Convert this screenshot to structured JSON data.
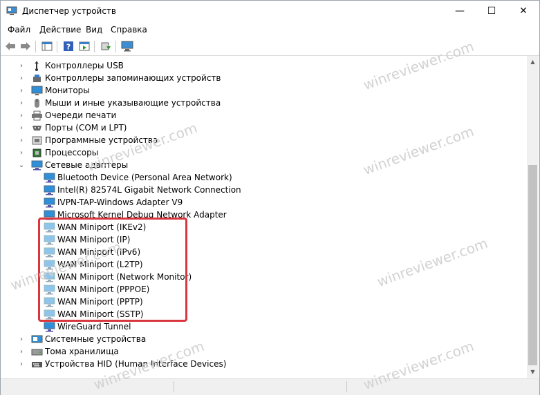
{
  "window": {
    "title": "Диспетчер устройств",
    "minimize": "—",
    "maximize": "☐",
    "close": "✕"
  },
  "menu": [
    "Файл",
    "Действие",
    "Вид",
    "Справка"
  ],
  "tree": [
    {
      "label": "Контроллеры USB",
      "icon": "usb-controller-icon",
      "expander": "›"
    },
    {
      "label": "Контроллеры запоминающих устройств",
      "icon": "storage-controller-icon",
      "expander": "›"
    },
    {
      "label": "Мониторы",
      "icon": "monitor-icon",
      "expander": "›"
    },
    {
      "label": "Мыши и иные указывающие устройства",
      "icon": "mouse-icon",
      "expander": "›"
    },
    {
      "label": "Очереди печати",
      "icon": "printer-icon",
      "expander": "›"
    },
    {
      "label": "Порты (COM и LPT)",
      "icon": "port-icon",
      "expander": "›"
    },
    {
      "label": "Программные устройства",
      "icon": "software-device-icon",
      "expander": "›"
    },
    {
      "label": "Процессоры",
      "icon": "processor-icon",
      "expander": "›"
    },
    {
      "label": "Сетевые адаптеры",
      "icon": "network-adapter-icon",
      "expander": "⌄"
    },
    {
      "label": "Bluetooth Device (Personal Area Network)",
      "icon": "network-adapter-icon",
      "child": true
    },
    {
      "label": "Intel(R) 82574L Gigabit Network Connection",
      "icon": "network-adapter-icon",
      "child": true
    },
    {
      "label": "IVPN-TAP-Windows Adapter V9",
      "icon": "network-adapter-icon",
      "child": true
    },
    {
      "label": "Microsoft Kernel Debug Network Adapter",
      "icon": "network-adapter-icon",
      "child": true
    },
    {
      "label": "WAN Miniport (IKEv2)",
      "icon": "network-adapter-icon",
      "child": true
    },
    {
      "label": "WAN Miniport (IP)",
      "icon": "network-adapter-icon",
      "child": true
    },
    {
      "label": "WAN Miniport (IPv6)",
      "icon": "network-adapter-icon",
      "child": true
    },
    {
      "label": "WAN Miniport (L2TP)",
      "icon": "network-adapter-icon",
      "child": true
    },
    {
      "label": "WAN Miniport (Network Monitor)",
      "icon": "network-adapter-icon",
      "child": true
    },
    {
      "label": "WAN Miniport (PPPOE)",
      "icon": "network-adapter-icon",
      "child": true
    },
    {
      "label": "WAN Miniport (PPTP)",
      "icon": "network-adapter-icon",
      "child": true
    },
    {
      "label": "WAN Miniport (SSTP)",
      "icon": "network-adapter-icon",
      "child": true
    },
    {
      "label": "WireGuard Tunnel",
      "icon": "network-adapter-icon",
      "child": true
    },
    {
      "label": "Системные устройства",
      "icon": "system-device-icon",
      "expander": "›"
    },
    {
      "label": "Тома хранилища",
      "icon": "storage-volume-icon",
      "expander": "›"
    },
    {
      "label": "Устройства HID (Human Interface Devices)",
      "icon": "hid-icon",
      "expander": "›"
    }
  ],
  "watermark": "winreviewer.com",
  "colors": {
    "highlight": "#d9363e",
    "adapter": "#2f8fd8",
    "adapter_dim": "#8fc4ec",
    "scroll_thumb": "#c2c2c2"
  }
}
